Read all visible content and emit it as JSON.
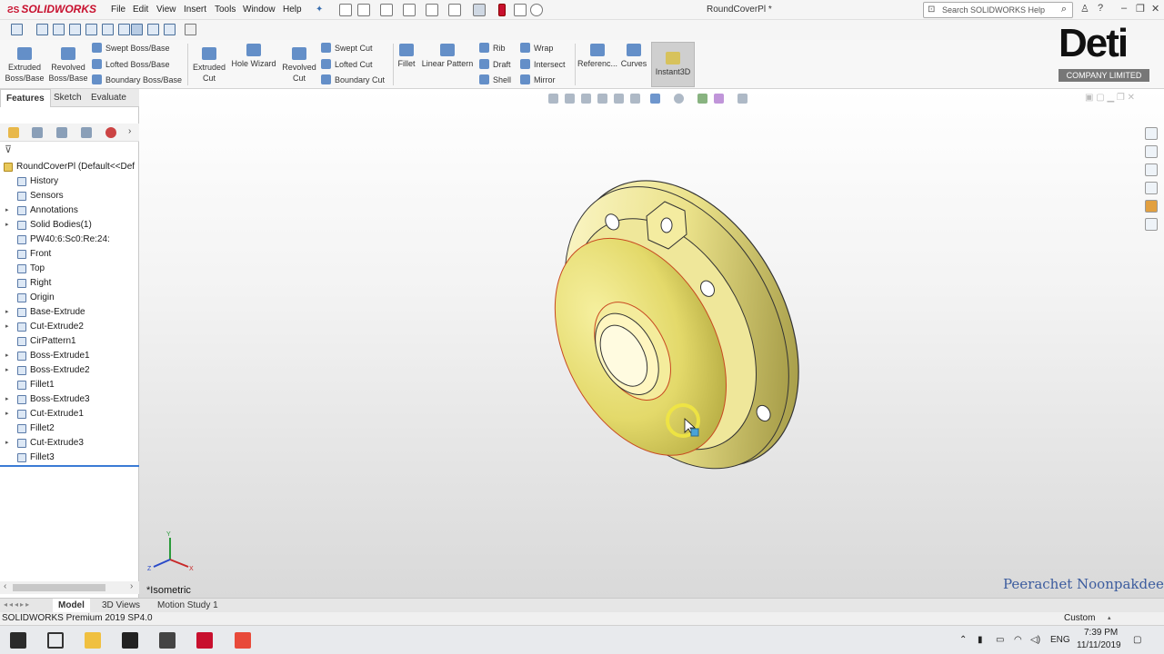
{
  "app": {
    "brand": "SOLIDWORKS",
    "window_title": "RoundCoverPl *",
    "menus": [
      "File",
      "Edit",
      "View",
      "Insert",
      "Tools",
      "Window",
      "Help"
    ],
    "search_placeholder": "Search SOLIDWORKS Help"
  },
  "ribbon": {
    "extruded_boss": "Extruded Boss/Base",
    "revolved_boss": "Revolved Boss/Base",
    "swept_boss": "Swept Boss/Base",
    "lofted_boss": "Lofted Boss/Base",
    "boundary_boss": "Boundary Boss/Base",
    "extruded_cut": "Extruded Cut",
    "hole_wizard": "Hole Wizard",
    "revolved_cut": "Revolved Cut",
    "swept_cut": "Swept Cut",
    "lofted_cut": "Lofted Cut",
    "boundary_cut": "Boundary Cut",
    "fillet": "Fillet",
    "linear_pattern": "Linear Pattern",
    "rib": "Rib",
    "draft": "Draft",
    "shell": "Shell",
    "wrap": "Wrap",
    "intersect": "Intersect",
    "mirror": "Mirror",
    "reference": "Referenc...",
    "curves": "Curves",
    "instant3d": "Instant3D"
  },
  "watermark": {
    "logo": "Deti",
    "company": "COMPANY LIMITED",
    "signature": "Peerachet Noonpakdee"
  },
  "tabs": [
    "Features",
    "Sketch",
    "Evaluate"
  ],
  "tree": {
    "root": "RoundCoverPl  (Default<<Def",
    "items": [
      {
        "label": "History",
        "expand": false
      },
      {
        "label": "Sensors",
        "expand": false
      },
      {
        "label": "Annotations",
        "expand": true
      },
      {
        "label": "Solid Bodies(1)",
        "expand": true
      },
      {
        "label": "PW40:6:Sc0:Re:24:",
        "expand": false
      },
      {
        "label": "Front",
        "expand": false
      },
      {
        "label": "Top",
        "expand": false
      },
      {
        "label": "Right",
        "expand": false
      },
      {
        "label": "Origin",
        "expand": false
      },
      {
        "label": "Base-Extrude",
        "expand": true
      },
      {
        "label": "Cut-Extrude2",
        "expand": true
      },
      {
        "label": "CirPattern1",
        "expand": false
      },
      {
        "label": "Boss-Extrude1",
        "expand": true
      },
      {
        "label": "Boss-Extrude2",
        "expand": true
      },
      {
        "label": "Fillet1",
        "expand": false
      },
      {
        "label": "Boss-Extrude3",
        "expand": true
      },
      {
        "label": "Cut-Extrude1",
        "expand": true
      },
      {
        "label": "Fillet2",
        "expand": false
      },
      {
        "label": "Cut-Extrude3",
        "expand": true
      },
      {
        "label": "Fillet3",
        "expand": false
      }
    ]
  },
  "viewport": {
    "view_label": "*Isometric",
    "triad": {
      "x": "X",
      "y": "Y",
      "z": "Z"
    }
  },
  "bottom_tabs": [
    "Model",
    "3D Views",
    "Motion Study 1"
  ],
  "status": {
    "version": "SOLIDWORKS Premium 2019 SP4.0",
    "units": "Custom"
  },
  "taskbar": {
    "lang": "ENG",
    "time": "7:39 PM",
    "date": "11/11/2019"
  },
  "colors": {
    "part": "#e3d96a",
    "part_edge": "#3a3a10",
    "accent": "#c8102e"
  }
}
